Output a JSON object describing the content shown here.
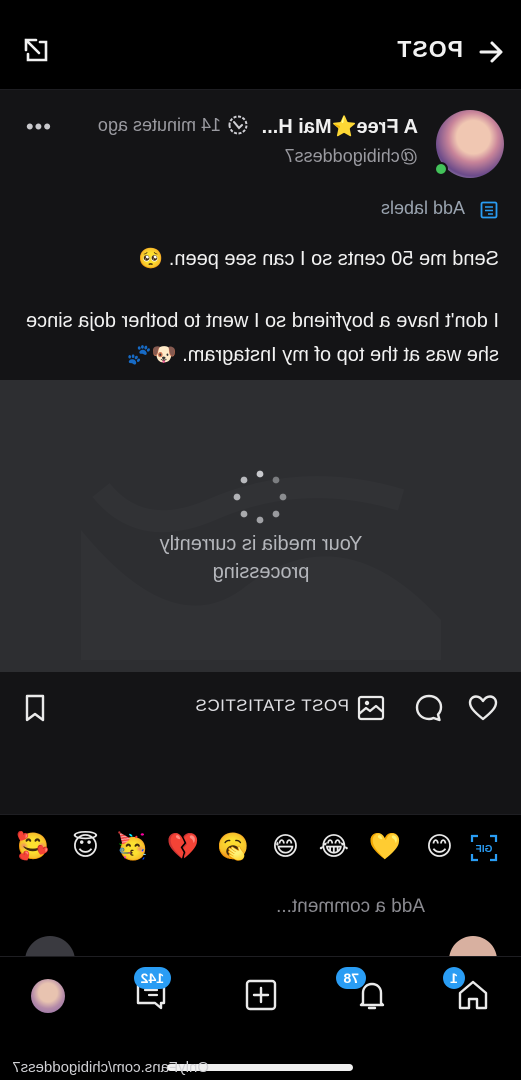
{
  "header": {
    "title": "POST",
    "back_icon": "arrow-left-icon",
    "share_icon": "share-icon"
  },
  "post": {
    "author_name": "A Free⭐Mai H...",
    "verified_icon": "verified-badge-icon",
    "time": "14 minutes ago",
    "handle": "@chibigoddess7",
    "more_icon": "more-dots-icon",
    "online_color": "#43c25a",
    "labels_text": "Add labels",
    "text_line1": "Send me 50 cents so I can see peen. 🥺",
    "text_line2": "I don't have a boyfriend so I went to bother doja since she was at the top of my Instagram. 🐶🐾"
  },
  "media": {
    "status": "Your media is currently processing"
  },
  "actions": {
    "like_icon": "heart-icon",
    "comment_icon": "comment-icon",
    "tip_icon": "tip-icon",
    "stats_label": "POST STATISTICS",
    "bookmark_icon": "bookmark-icon"
  },
  "emoji_bar": {
    "gif_icon": "gif-icon",
    "emojis": [
      "😊",
      "💛",
      "😂",
      "😅",
      "🥱",
      "💔",
      "🥳",
      "😇",
      "🥰"
    ]
  },
  "comment": {
    "placeholder": "Add a comment..."
  },
  "tabbar": {
    "home_badge": "1",
    "notifications_badge": "78",
    "messages_badge": "142",
    "accent": "#2a9df4"
  },
  "footer": {
    "url": "OnlyFans.com/chibigoddess7"
  }
}
